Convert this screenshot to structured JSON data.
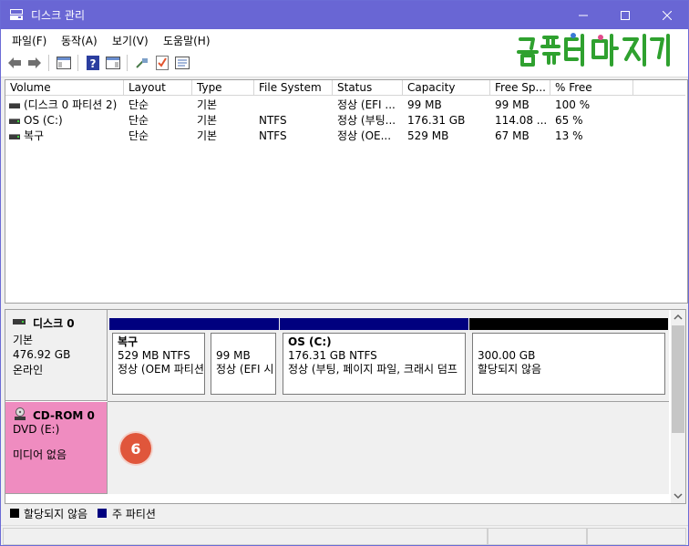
{
  "window": {
    "title": "디스크 관리"
  },
  "menu": [
    "파일(F)",
    "동작(A)",
    "보기(V)",
    "도움말(H)"
  ],
  "brand": {
    "text": "컴퓨터 마 지 기"
  },
  "columns": [
    "Volume",
    "Layout",
    "Type",
    "File System",
    "Status",
    "Capacity",
    "Free Sp...",
    "% Free"
  ],
  "volumes": [
    {
      "volume": "(디스크 0 파티션 2)",
      "layout": "단순",
      "type": "기본",
      "fs": "",
      "status": "정상 (EFI ...",
      "capacity": "99 MB",
      "free": "99 MB",
      "pct": "100 %"
    },
    {
      "volume": "OS (C:)",
      "layout": "단순",
      "type": "기본",
      "fs": "NTFS",
      "status": "정상 (부팅...",
      "capacity": "176.31 GB",
      "free": "114.08 ...",
      "pct": "65 %"
    },
    {
      "volume": "복구",
      "layout": "단순",
      "type": "기본",
      "fs": "NTFS",
      "status": "정상 (OE...",
      "capacity": "529 MB",
      "free": "67 MB",
      "pct": "13 %"
    }
  ],
  "disk0": {
    "name": "디스크 0",
    "type": "기본",
    "size": "476.92 GB",
    "state": "온라인",
    "partitions": [
      {
        "name": "복구",
        "size": "529 MB NTFS",
        "status": "정상 (OEM 파티션)",
        "color": "#00007f"
      },
      {
        "name": "",
        "size": "99 MB",
        "status": "정상 (EFI 시",
        "color": "#00007f"
      },
      {
        "name": "OS  (C:)",
        "size": "176.31 GB NTFS",
        "status": "정상 (부팅, 페이지 파일, 크래시 덤프",
        "color": "#00007f"
      },
      {
        "name": "",
        "size": "300.00 GB",
        "status": "할당되지 않음",
        "color": "#000000"
      }
    ]
  },
  "cdrom": {
    "name": "CD-ROM 0",
    "drive": "DVD (E:)",
    "media": "미디어 없음"
  },
  "annotation": {
    "number": "6"
  },
  "legend": [
    {
      "label": "할당되지 않음",
      "color": "#000000"
    },
    {
      "label": "주 파티션",
      "color": "#00007f"
    }
  ]
}
